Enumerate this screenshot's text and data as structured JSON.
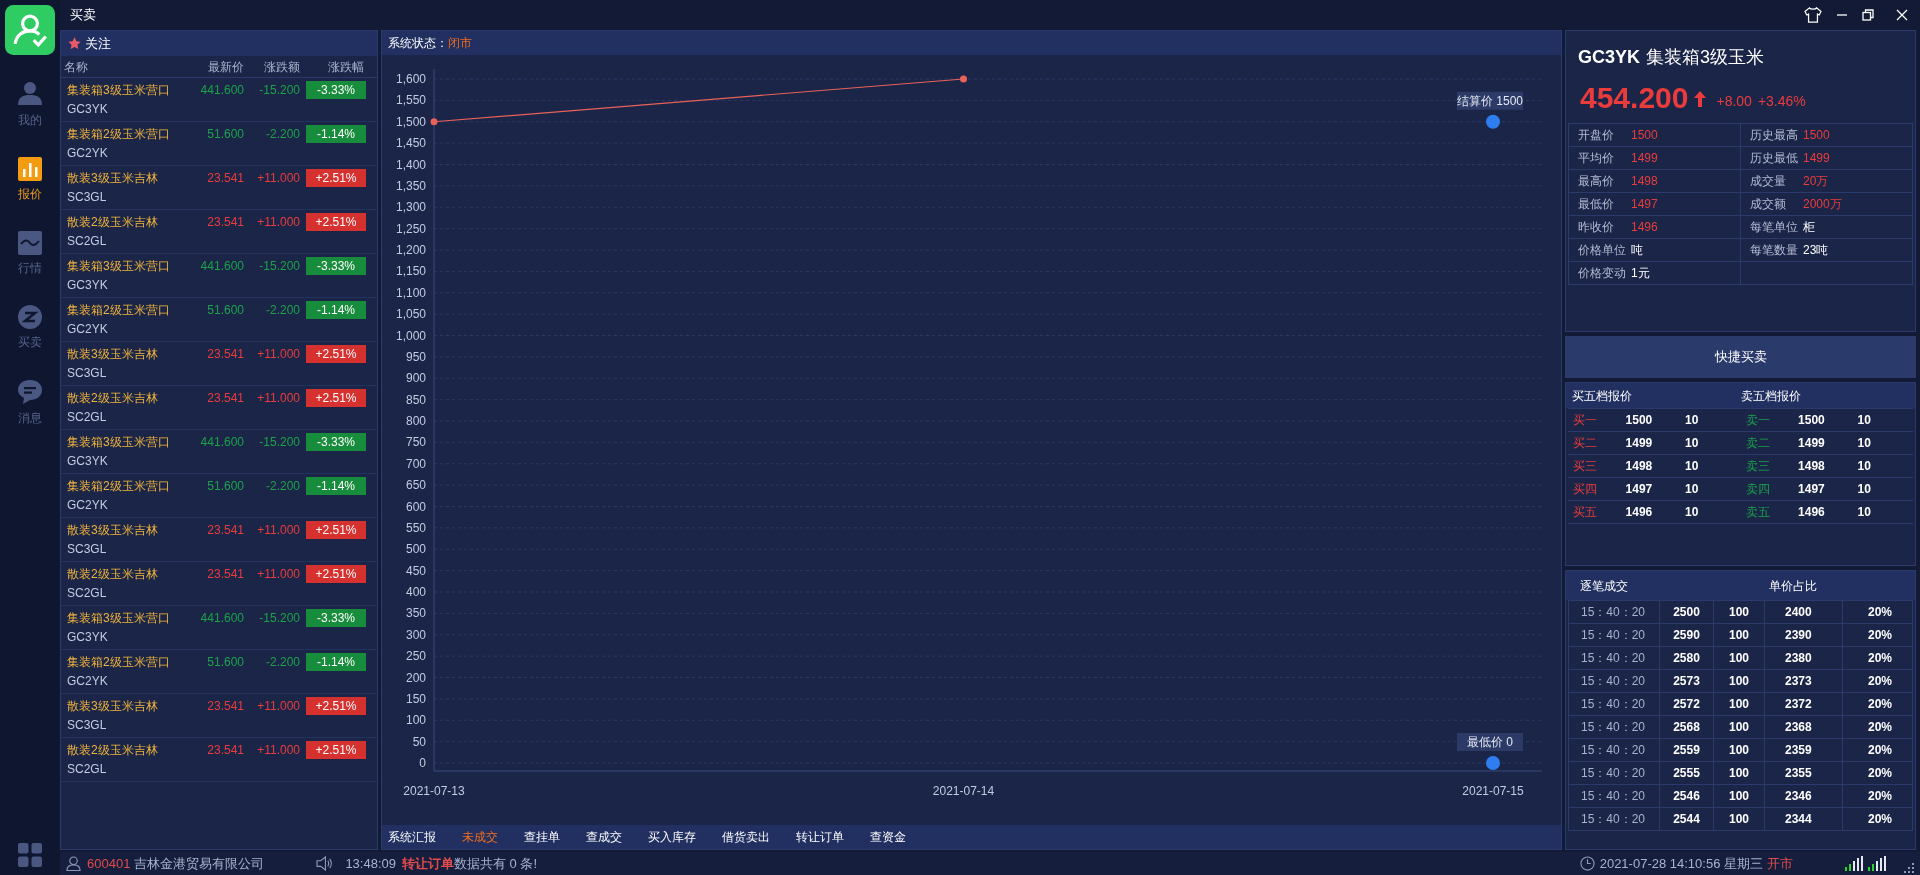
{
  "window": {
    "title": "买卖"
  },
  "sidebar": {
    "items": [
      {
        "label": "我的",
        "kind": "person",
        "selected": false
      },
      {
        "label": "报价",
        "kind": "bars",
        "selected": true
      },
      {
        "label": "行情",
        "kind": "wave",
        "selected": false
      },
      {
        "label": "买卖",
        "kind": "exchange",
        "selected": false
      },
      {
        "label": "消息",
        "kind": "chat",
        "selected": false
      }
    ]
  },
  "watchlist": {
    "title": "关注",
    "columns": [
      "名称",
      "最新价",
      "涨跌额",
      "涨跌幅"
    ],
    "rows": [
      {
        "name": "集装箱3级玉米营口",
        "code": "GC3YK",
        "price": "441.600",
        "change": "-15.200",
        "pct": "-3.33%",
        "kind": "down"
      },
      {
        "name": "集装箱2级玉米营口",
        "code": "GC2YK",
        "price": "51.600",
        "change": "-2.200",
        "pct": "-1.14%",
        "kind": "down"
      },
      {
        "name": "散装3级玉米吉林",
        "code": "SC3GL",
        "price": "23.541",
        "change": "+11.000",
        "pct": "+2.51%",
        "kind": "up"
      },
      {
        "name": "散装2级玉米吉林",
        "code": "SC2GL",
        "price": "23.541",
        "change": "+11.000",
        "pct": "+2.51%",
        "kind": "up"
      },
      {
        "name": "集装箱3级玉米营口",
        "code": "GC3YK",
        "price": "441.600",
        "change": "-15.200",
        "pct": "-3.33%",
        "kind": "down"
      },
      {
        "name": "集装箱2级玉米营口",
        "code": "GC2YK",
        "price": "51.600",
        "change": "-2.200",
        "pct": "-1.14%",
        "kind": "down"
      },
      {
        "name": "散装3级玉米吉林",
        "code": "SC3GL",
        "price": "23.541",
        "change": "+11.000",
        "pct": "+2.51%",
        "kind": "up"
      },
      {
        "name": "散装2级玉米吉林",
        "code": "SC2GL",
        "price": "23.541",
        "change": "+11.000",
        "pct": "+2.51%",
        "kind": "up"
      },
      {
        "name": "集装箱3级玉米营口",
        "code": "GC3YK",
        "price": "441.600",
        "change": "-15.200",
        "pct": "-3.33%",
        "kind": "down"
      },
      {
        "name": "集装箱2级玉米营口",
        "code": "GC2YK",
        "price": "51.600",
        "change": "-2.200",
        "pct": "-1.14%",
        "kind": "down"
      },
      {
        "name": "散装3级玉米吉林",
        "code": "SC3GL",
        "price": "23.541",
        "change": "+11.000",
        "pct": "+2.51%",
        "kind": "up"
      },
      {
        "name": "散装2级玉米吉林",
        "code": "SC2GL",
        "price": "23.541",
        "change": "+11.000",
        "pct": "+2.51%",
        "kind": "up"
      },
      {
        "name": "集装箱3级玉米营口",
        "code": "GC3YK",
        "price": "441.600",
        "change": "-15.200",
        "pct": "-3.33%",
        "kind": "down"
      },
      {
        "name": "集装箱2级玉米营口",
        "code": "GC2YK",
        "price": "51.600",
        "change": "-2.200",
        "pct": "-1.14%",
        "kind": "down"
      },
      {
        "name": "散装3级玉米吉林",
        "code": "SC3GL",
        "price": "23.541",
        "change": "+11.000",
        "pct": "+2.51%",
        "kind": "up"
      },
      {
        "name": "散装2级玉米吉林",
        "code": "SC2GL",
        "price": "23.541",
        "change": "+11.000",
        "pct": "+2.51%",
        "kind": "up"
      }
    ]
  },
  "chart_panel": {
    "status_label": "系统状态：",
    "status_value": "闭市",
    "chart_data": {
      "type": "line",
      "categories": [
        "2021-07-13",
        "2021-07-14",
        "2021-07-15"
      ],
      "series": [
        {
          "color": "#e8625a",
          "marker": "circle",
          "values": [
            1500,
            1600,
            null
          ]
        }
      ],
      "grid": true,
      "ylim": [
        0,
        1600
      ],
      "yticks": [
        0,
        50,
        100,
        150,
        200,
        250,
        300,
        350,
        400,
        450,
        500,
        550,
        600,
        650,
        700,
        750,
        800,
        850,
        900,
        950,
        {
          "value": 1000,
          "label": "1,000"
        },
        {
          "value": 1050,
          "label": "1,050"
        },
        {
          "value": 1100,
          "label": "1,100"
        },
        {
          "value": 1150,
          "label": "1,150"
        },
        {
          "value": 1200,
          "label": "1,200"
        },
        {
          "value": 1250,
          "label": "1,250"
        },
        {
          "value": 1300,
          "label": "1,300"
        },
        {
          "value": 1350,
          "label": "1,350"
        },
        {
          "value": 1400,
          "label": "1,400"
        },
        {
          "value": 1450,
          "label": "1,450"
        },
        {
          "value": 1500,
          "label": "1,500"
        },
        {
          "value": 1550,
          "label": "1,550"
        },
        {
          "value": 1600,
          "label": "1,600"
        }
      ],
      "annotations": [
        {
          "text": "结算价 1500",
          "x": "2021-07-15",
          "y": 1500
        },
        {
          "text": "最低价 0",
          "x": "2021-07-15",
          "y": 0
        }
      ]
    },
    "tabs": [
      {
        "label": "系统汇报",
        "selected": false
      },
      {
        "label": "未成交",
        "selected": true
      },
      {
        "label": "查挂单",
        "selected": false
      },
      {
        "label": "查成交",
        "selected": false
      },
      {
        "label": "买入库存",
        "selected": false
      },
      {
        "label": "借货卖出",
        "selected": false
      },
      {
        "label": "转让订单",
        "selected": false
      },
      {
        "label": "查资金",
        "selected": false
      }
    ]
  },
  "quote": {
    "code": "GC3YK",
    "name": "集装箱3级玉米",
    "price": "454.200",
    "kind": "up",
    "change": "+8.00",
    "pct": "+3.46%",
    "fields": [
      {
        "label": "开盘价",
        "value": "1500",
        "highlight": true
      },
      {
        "label": "历史最高",
        "value": "1500",
        "highlight": true
      },
      {
        "label": "平均价",
        "value": "1499",
        "highlight": true
      },
      {
        "label": "历史最低",
        "value": "1499",
        "highlight": true
      },
      {
        "label": "最高价",
        "value": "1498",
        "highlight": true
      },
      {
        "label": "成交量",
        "value": "20万",
        "highlight": true
      },
      {
        "label": "最低价",
        "value": "1497",
        "highlight": true
      },
      {
        "label": "成交额",
        "value": "2000万",
        "highlight": true
      },
      {
        "label": "昨收价",
        "value": "1496",
        "highlight": true
      },
      {
        "label": "每笔单位",
        "value": "柜",
        "highlight": false
      },
      {
        "label": "价格单位",
        "value": "吨",
        "highlight": false
      },
      {
        "label": "每笔数量",
        "value": "23吨",
        "highlight": false
      },
      {
        "label": "价格变动",
        "value": "1元",
        "highlight": false
      }
    ]
  },
  "quick_trade_button": "快捷买卖",
  "order_book": {
    "bid_title": "买五档报价",
    "ask_title": "卖五档报价",
    "bids": [
      {
        "label": "买一",
        "price": "1500",
        "qty": "10"
      },
      {
        "label": "买二",
        "price": "1499",
        "qty": "10"
      },
      {
        "label": "买三",
        "price": "1498",
        "qty": "10"
      },
      {
        "label": "买四",
        "price": "1497",
        "qty": "10"
      },
      {
        "label": "买五",
        "price": "1496",
        "qty": "10"
      }
    ],
    "asks": [
      {
        "label": "卖一",
        "price": "1500",
        "qty": "10"
      },
      {
        "label": "卖二",
        "price": "1499",
        "qty": "10"
      },
      {
        "label": "卖三",
        "price": "1498",
        "qty": "10"
      },
      {
        "label": "卖四",
        "price": "1497",
        "qty": "10"
      },
      {
        "label": "卖五",
        "price": "1496",
        "qty": "10"
      }
    ]
  },
  "trades": {
    "title": "逐笔成交",
    "title_2": "单价占比",
    "rows": [
      {
        "time": "15：40：20",
        "price": "2500",
        "qty": "100",
        "unit_price": "2400",
        "ratio": "20%"
      },
      {
        "time": "15：40：20",
        "price": "2590",
        "qty": "100",
        "unit_price": "2390",
        "ratio": "20%"
      },
      {
        "time": "15：40：20",
        "price": "2580",
        "qty": "100",
        "unit_price": "2380",
        "ratio": "20%"
      },
      {
        "time": "15：40：20",
        "price": "2573",
        "qty": "100",
        "unit_price": "2373",
        "ratio": "20%"
      },
      {
        "time": "15：40：20",
        "price": "2572",
        "qty": "100",
        "unit_price": "2372",
        "ratio": "20%"
      },
      {
        "time": "15：40：20",
        "price": "2568",
        "qty": "100",
        "unit_price": "2368",
        "ratio": "20%"
      },
      {
        "time": "15：40：20",
        "price": "2559",
        "qty": "100",
        "unit_price": "2359",
        "ratio": "20%"
      },
      {
        "time": "15：40：20",
        "price": "2555",
        "qty": "100",
        "unit_price": "2355",
        "ratio": "20%"
      },
      {
        "time": "15：40：20",
        "price": "2546",
        "qty": "100",
        "unit_price": "2346",
        "ratio": "20%"
      },
      {
        "time": "15：40：20",
        "price": "2544",
        "qty": "100",
        "unit_price": "2344",
        "ratio": "20%"
      }
    ]
  },
  "status_bar": {
    "account": "600401",
    "company": "吉林金港贸易有限公司",
    "message_time": "13:48:09",
    "message_link": "转让订单",
    "message_text": "数据共有 0 条!",
    "datetime": "2021-07-28 14:10:56 星期三",
    "market_state": "开市"
  }
}
